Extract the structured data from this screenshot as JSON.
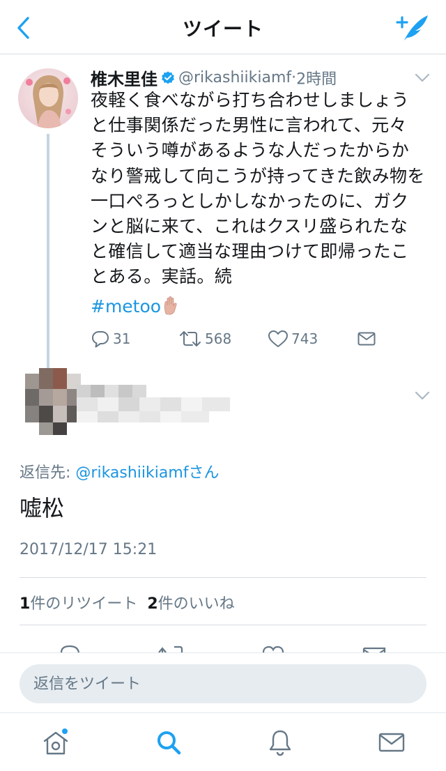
{
  "header": {
    "title": "ツイート"
  },
  "tweet": {
    "author": "椎木里佳",
    "handle": "@rikashiikiamf",
    "separator": "·",
    "time": "2時間",
    "lines": [
      "夜軽く食べながら打ち合わせしましょう",
      "と仕事関係だった男性に言われて、元々",
      "そういう噂があるような人だったからか",
      "なり警戒して向こうが持ってきた飲み物を",
      "一口ぺろっとしかしなかったのに、ガク",
      "ンと脳に来て、これはクスリ盛られたな",
      "と確信して適当な理由つけて即帰ったこ",
      "とある。実話。続"
    ],
    "hashtag": "#metoo",
    "actions": {
      "replies": "31",
      "retweets": "568",
      "likes": "743"
    }
  },
  "reply": {
    "reply_to_prefix": "返信先: ",
    "reply_to_handle": "@rikashiikiamf",
    "reply_to_suffix": "さん",
    "text": "嘘松",
    "timestamp": "2017/12/17 15:21",
    "stats": {
      "retweet_count": "1",
      "retweet_label": "件のリツイート",
      "like_count": "2",
      "like_label": "件のいいね"
    }
  },
  "composer": {
    "placeholder": "返信をツイート"
  },
  "colors": {
    "accent": "#1da1f2",
    "link": "#1b95e0",
    "secondary": "#657786",
    "divider": "#d6dbe0"
  },
  "icons": {
    "back": "chevron-left-icon",
    "compose": "compose-feather-icon",
    "verified": "verified-badge-icon",
    "reply": "reply-icon",
    "retweet": "retweet-icon",
    "like": "heart-icon",
    "dm": "envelope-icon",
    "home": "home-icon",
    "search": "search-icon",
    "notifications": "bell-icon",
    "messages": "envelope-icon"
  },
  "tabbar": {
    "active": "search",
    "home_has_new": true
  }
}
